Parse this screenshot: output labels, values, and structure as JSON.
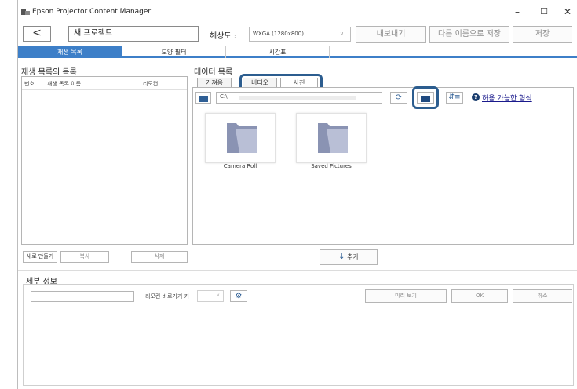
{
  "window": {
    "title": "Epson Projector Content Manager",
    "controls": [
      "—",
      "☐",
      "✕"
    ]
  },
  "toolbar": {
    "back_label": "<",
    "project_name": "새 프로젝트",
    "resolution_label": "해상도 :",
    "resolution_value": "WXGA (1280x800)",
    "export_label": "내보내기",
    "save_as_label": "다른 이름으로 저장",
    "save_label": "저장"
  },
  "tabs": [
    {
      "label": "재생 목록",
      "active": true
    },
    {
      "label": "모양 필터",
      "active": false
    },
    {
      "label": "시간표",
      "active": false
    }
  ],
  "playlist": {
    "title": "재생 목록의 목록",
    "columns": [
      "번호",
      "재생 목록 이름",
      "리모컨"
    ],
    "new_label": "새로 만들기",
    "copy_label": "복사",
    "delete_label": "삭제"
  },
  "data_list": {
    "title": "데이터 목록",
    "subtabs": [
      {
        "label": "가져옴",
        "active": false
      },
      {
        "label": "비디오",
        "active": false
      },
      {
        "label": "사진",
        "active": true
      }
    ],
    "path": "C:\\",
    "supported_formats_label": "허용 가능한 형식",
    "items": [
      {
        "label": "Camera Roll"
      },
      {
        "label": "Saved Pictures"
      }
    ],
    "add_label": "추가",
    "accent_color": "#2c5d8f"
  },
  "details": {
    "title": "세부 정보",
    "shortcut_label": "리모컨 바로가기 키",
    "preview_label": "미리 보기",
    "ok_label": "OK",
    "cancel_label": "취소"
  }
}
